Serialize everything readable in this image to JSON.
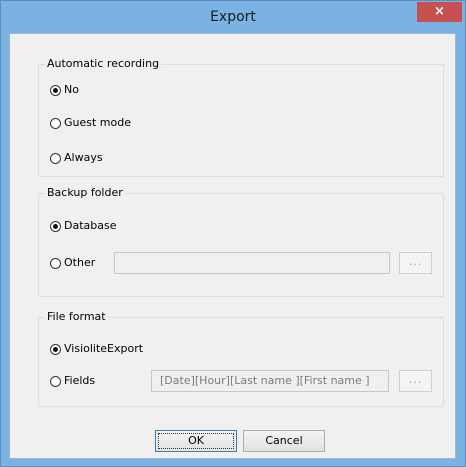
{
  "window": {
    "title": "Export",
    "close_glyph": "×"
  },
  "recording": {
    "title": "Automatic recording",
    "options": [
      {
        "label": "No",
        "checked": true
      },
      {
        "label": "Guest mode",
        "checked": false
      },
      {
        "label": "Always",
        "checked": false
      }
    ]
  },
  "backup": {
    "title": "Backup folder",
    "options": [
      {
        "label": "Database",
        "checked": true
      },
      {
        "label": "Other",
        "checked": false
      }
    ],
    "path_value": "",
    "browse_label": "..."
  },
  "format": {
    "title": "File format",
    "options": [
      {
        "label": "VisioliteExport",
        "checked": true
      },
      {
        "label": "Fields",
        "checked": false
      }
    ],
    "fields_value": "[Date][Hour][Last name ][First name ]",
    "browse_label": "..."
  },
  "buttons": {
    "ok_label": "OK",
    "cancel_label": "Cancel"
  },
  "colors": {
    "title_bar": "#7ab3e3",
    "close_button": "#c75050",
    "dialog_face": "#f0f0f0"
  }
}
